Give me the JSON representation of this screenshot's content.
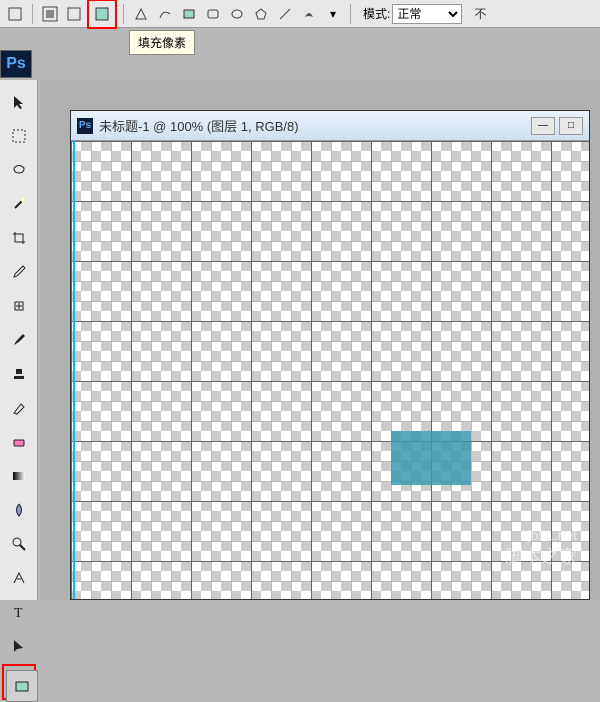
{
  "options_bar": {
    "mode_label": "模式:",
    "mode_value": "正常",
    "extra": "不",
    "tooltip": "填充像素"
  },
  "app": {
    "badge": "Ps"
  },
  "document": {
    "title": "未标题-1 @ 100% (图层 1, RGB/8)"
  },
  "colors": {
    "foreground": "#2a8da3",
    "background": "#ffffff",
    "shape": "#3a9aaf",
    "highlight": "red"
  },
  "watermark": {
    "url": "jb51.net",
    "text": "脚本之家"
  }
}
